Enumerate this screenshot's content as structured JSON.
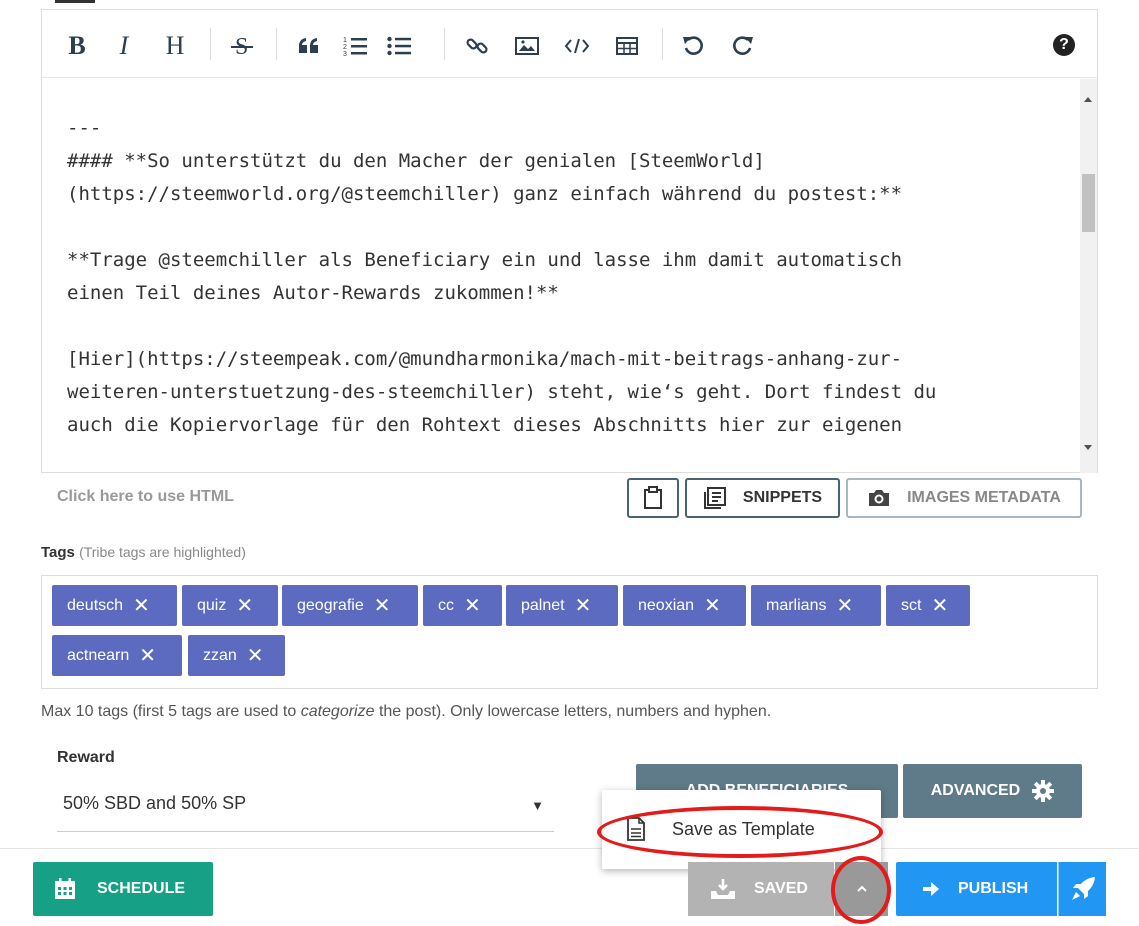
{
  "toolbar": {
    "bold": "B",
    "italic": "I",
    "heading": "H",
    "help": "?"
  },
  "editor": {
    "lines": [
      "",
      "---",
      "#### **So unterstützt du den Macher der genialen [SteemWorld]",
      "(https://steemworld.org/@steemchiller) ganz einfach während du postest:**",
      "",
      "**Trage @steemchiller als Beneficiary ein und lasse ihm damit automatisch",
      "einen Teil deines Autor-Rewards zukommen!**",
      "",
      "[Hier](https://steempeak.com/@mundharmonika/mach-mit-beitrags-anhang-zur-",
      "weiteren-unterstuetzung-des-steemchiller) steht, wie‘s geht. Dort findest du",
      "auch die Kopiervorlage für den Rohtext dieses Abschnitts hier zur eigenen"
    ]
  },
  "below_editor": {
    "html_link": "Click here to use HTML",
    "snippets": "SNIPPETS",
    "images_metadata": "IMAGES METADATA"
  },
  "tags": {
    "label": "Tags",
    "hint": "(Tribe tags are highlighted)",
    "items": [
      "deutsch",
      "quiz",
      "geografie",
      "cc",
      "palnet",
      "neoxian",
      "marlians",
      "sct",
      "actnearn",
      "zzan"
    ],
    "remove_glyph": "✕",
    "note_prefix": "Max 10 tags (first 5 tags are used to ",
    "note_em": "categorize",
    "note_suffix": " the post). Only lowercase letters, numbers and hyphen."
  },
  "reward": {
    "label": "Reward",
    "selected": "50% SBD and 50% SP"
  },
  "buttons": {
    "add_beneficiaries": "ADD BENEFICIARIES",
    "advanced": "ADVANCED",
    "schedule": "SCHEDULE",
    "saved": "SAVED",
    "publish": "PUBLISH"
  },
  "popup": {
    "save_as_template": "Save as Template"
  },
  "colors": {
    "tag_bg": "#5c6bc0",
    "schedule_bg": "#16a085",
    "publish_bg": "#2196f3",
    "highlight_ring": "#e41b1b"
  }
}
